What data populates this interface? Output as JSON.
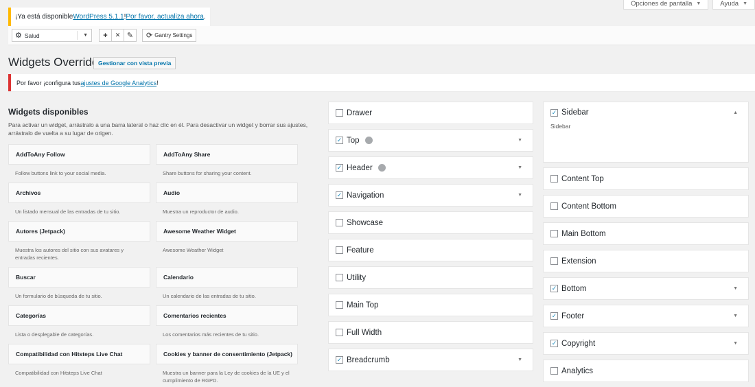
{
  "screen_meta": {
    "options_label": "Opciones de pantalla",
    "help_label": "Ayuda"
  },
  "update_notice": {
    "prefix": "¡Ya está disponible ",
    "version_link": "WordPress 5.1.1",
    "middle": "! ",
    "update_link": "Por favor, actualiza ahora",
    "suffix": "."
  },
  "gantry": {
    "selected_outline": "Salud",
    "settings_label": "Gantry Settings"
  },
  "page": {
    "title": "Widgets Override",
    "preview_button": "Gestionar con vista previa"
  },
  "analytics_notice": {
    "prefix": "Por favor ¡configura tus ",
    "link": "ajustes de Google Analytics",
    "suffix": "!"
  },
  "available": {
    "title": "Widgets disponibles",
    "description": "Para activar un widget, arrástralo a una barra lateral o haz clic en él. Para desactivar un widget y borrar sus ajustes, arrástralo de vuelta a su lugar de origen.",
    "widgets": [
      {
        "name": "AddToAny Follow",
        "desc": "Follow buttons link to your social media."
      },
      {
        "name": "AddToAny Share",
        "desc": "Share buttons for sharing your content."
      },
      {
        "name": "Archivos",
        "desc": "Un listado mensual de las entradas de tu sitio."
      },
      {
        "name": "Audio",
        "desc": "Muestra un reproductor de audio."
      },
      {
        "name": "Autores (Jetpack)",
        "desc": "Muestra los autores del sitio con sus avatares y entradas recientes."
      },
      {
        "name": "Awesome Weather Widget",
        "desc": "Awesome Weather Widget"
      },
      {
        "name": "Buscar",
        "desc": "Un formulario de búsqueda de tu sitio."
      },
      {
        "name": "Calendario",
        "desc": "Un calendario de las entradas de tu sitio."
      },
      {
        "name": "Categorías",
        "desc": "Lista o desplegable de categorías."
      },
      {
        "name": "Comentarios recientes",
        "desc": "Los comentarios más recientes de tu sitio."
      },
      {
        "name": "Compatibilidad con Hitsteps Live Chat",
        "desc": "Compatibilidad con Hitsteps Live Chat"
      },
      {
        "name": "Cookies y banner de consentimiento (Jetpack)",
        "desc": "Muestra un banner para la Ley de cookies de la UE y el cumplimiento de RGPD."
      }
    ]
  },
  "middle_areas": [
    {
      "label": "Drawer",
      "checked": false,
      "toggle": false,
      "spinner": false
    },
    {
      "label": "Top",
      "checked": true,
      "toggle": true,
      "spinner": true
    },
    {
      "label": "Header",
      "checked": true,
      "toggle": true,
      "spinner": true
    },
    {
      "label": "Navigation",
      "checked": true,
      "toggle": true,
      "spinner": false
    },
    {
      "label": "Showcase",
      "checked": false,
      "toggle": false,
      "spinner": false
    },
    {
      "label": "Feature",
      "checked": false,
      "toggle": false,
      "spinner": false
    },
    {
      "label": "Utility",
      "checked": false,
      "toggle": false,
      "spinner": false
    },
    {
      "label": "Main Top",
      "checked": false,
      "toggle": false,
      "spinner": false
    },
    {
      "label": "Full Width",
      "checked": false,
      "toggle": false,
      "spinner": false
    },
    {
      "label": "Breadcrumb",
      "checked": true,
      "toggle": true,
      "spinner": false
    }
  ],
  "right_areas": [
    {
      "label": "Sidebar",
      "checked": true,
      "toggle": true,
      "open": true,
      "desc": "Sidebar"
    },
    {
      "label": "Content Top",
      "checked": false,
      "toggle": false
    },
    {
      "label": "Content Bottom",
      "checked": false,
      "toggle": false
    },
    {
      "label": "Main Bottom",
      "checked": false,
      "toggle": false
    },
    {
      "label": "Extension",
      "checked": false,
      "toggle": false
    },
    {
      "label": "Bottom",
      "checked": true,
      "toggle": true
    },
    {
      "label": "Footer",
      "checked": true,
      "toggle": true
    },
    {
      "label": "Copyright",
      "checked": true,
      "toggle": true
    },
    {
      "label": "Analytics",
      "checked": false,
      "toggle": false
    }
  ],
  "icons": {
    "check": "✓",
    "caret_down": "▼",
    "caret_up": "▲",
    "gear": "⚙",
    "plus": "+",
    "close": "✕",
    "edit": "✎",
    "refresh": "⟳"
  },
  "colors": {
    "link": "#0073aa",
    "update_border": "#ffb900",
    "error_border": "#dc3232",
    "check": "#1e8cbe"
  }
}
